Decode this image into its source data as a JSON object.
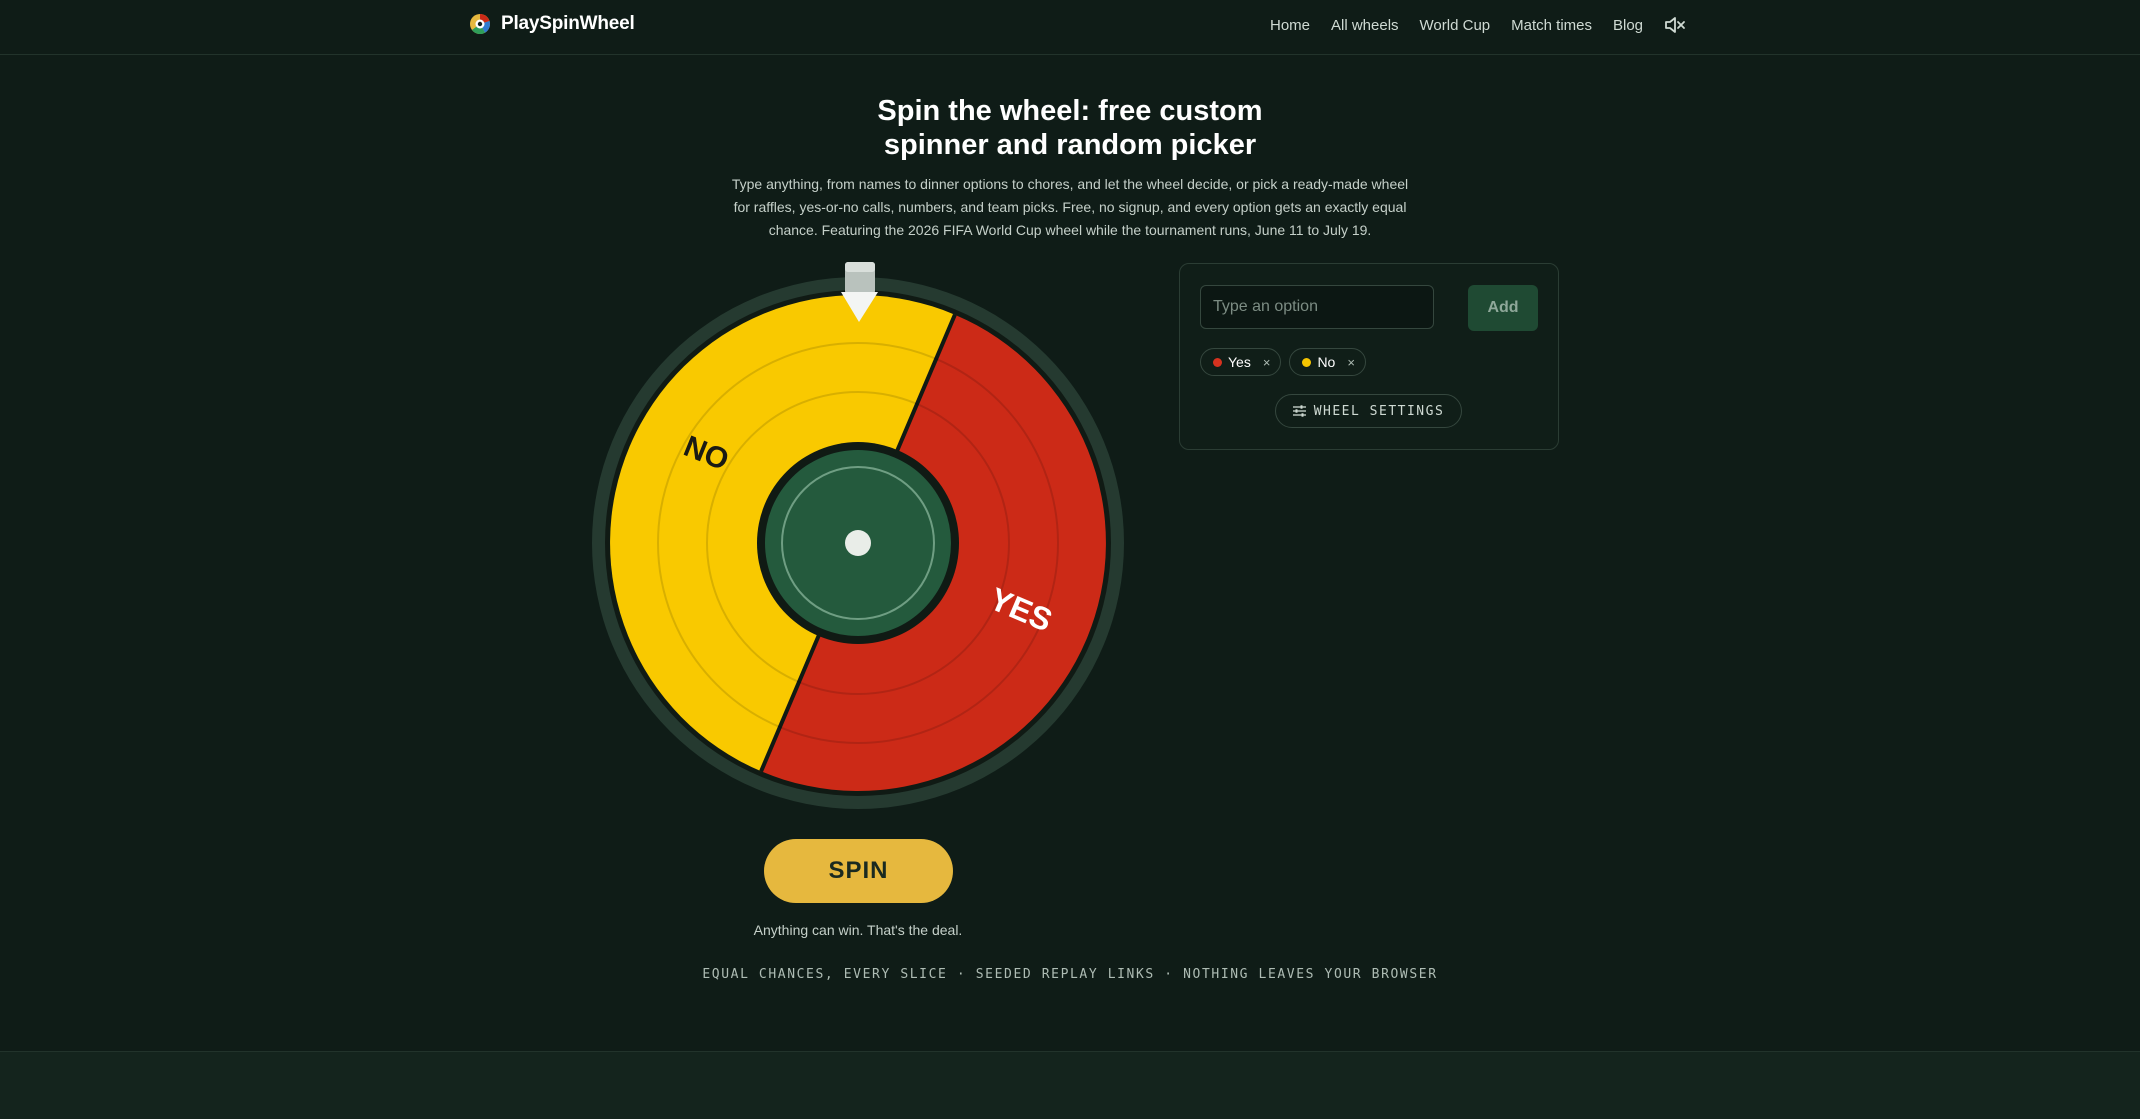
{
  "brand": {
    "name": "PlaySpinWheel"
  },
  "nav": {
    "items": [
      "Home",
      "All wheels",
      "World Cup",
      "Match times",
      "Blog"
    ],
    "mute_icon": "speaker-muted-icon"
  },
  "hero": {
    "title_line1": "Spin the wheel: free custom",
    "title_line2": "spinner and random picker",
    "description": "Type anything, from names to dinner options to chores, and let the wheel decide, or pick a ready-made wheel for raffles, yes-or-no calls, numbers, and team picks. Free, no signup, and every option gets an exactly equal chance. Featuring the 2026 FIFA World Cup wheel while the tournament runs, June 11 to July 19."
  },
  "wheel": {
    "segments": [
      {
        "label": "YES",
        "color": "#cc2a17"
      },
      {
        "label": "NO",
        "color": "#f9c900"
      }
    ],
    "hub_color": "#245a3d",
    "rim_color": "#253a30"
  },
  "controls": {
    "spin_label": "SPIN",
    "tagline": "Anything can win. That's the deal.",
    "footer_line": "EQUAL CHANCES, EVERY SLICE · SEEDED REPLAY LINKS · NOTHING LEAVES YOUR BROWSER"
  },
  "options_panel": {
    "input_placeholder": "Type an option",
    "add_label": "Add",
    "chips": [
      {
        "label": "Yes",
        "color": "#d6321f"
      },
      {
        "label": "No",
        "color": "#f5c400"
      }
    ],
    "remove_glyph": "×",
    "settings_label": "WHEEL SETTINGS",
    "settings_icon": "sliders-icon"
  }
}
